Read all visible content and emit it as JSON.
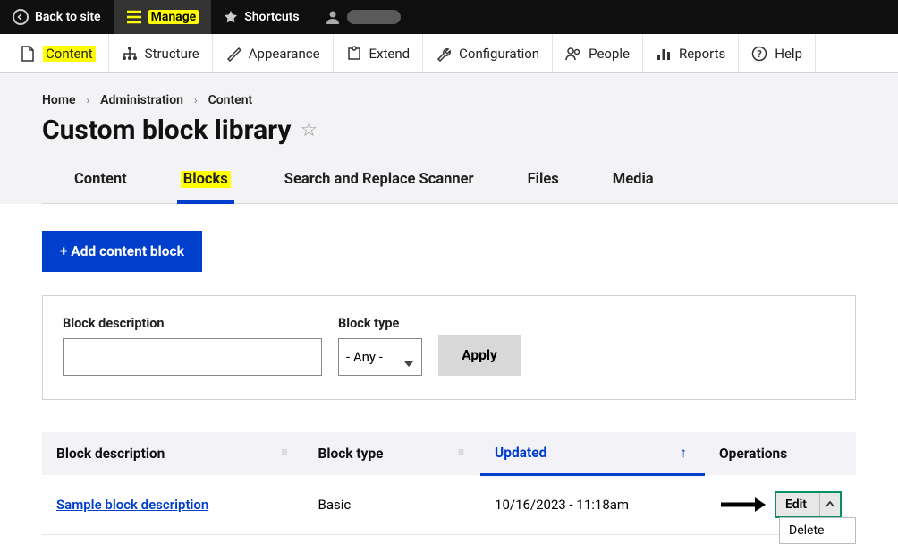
{
  "toolbar": {
    "back": "Back to site",
    "manage": "Manage",
    "shortcuts": "Shortcuts"
  },
  "admin_menu": {
    "content": "Content",
    "structure": "Structure",
    "appearance": "Appearance",
    "extend": "Extend",
    "configuration": "Configuration",
    "people": "People",
    "reports": "Reports",
    "help": "Help"
  },
  "breadcrumb": {
    "home": "Home",
    "admin": "Administration",
    "content": "Content"
  },
  "page_title": "Custom block library",
  "tabs": {
    "content": "Content",
    "blocks": "Blocks",
    "scanner": "Search and Replace Scanner",
    "files": "Files",
    "media": "Media"
  },
  "add_button": "+ Add content block",
  "filters": {
    "desc_label": "Block description",
    "type_label": "Block type",
    "type_value": "- Any -",
    "apply": "Apply"
  },
  "table": {
    "headers": {
      "description": "Block description",
      "type": "Block type",
      "updated": "Updated",
      "operations": "Operations"
    },
    "rows": [
      {
        "description": "Sample block description",
        "type": "Basic",
        "updated": "10/16/2023 - 11:18am",
        "edit": "Edit",
        "delete": "Delete"
      }
    ]
  }
}
